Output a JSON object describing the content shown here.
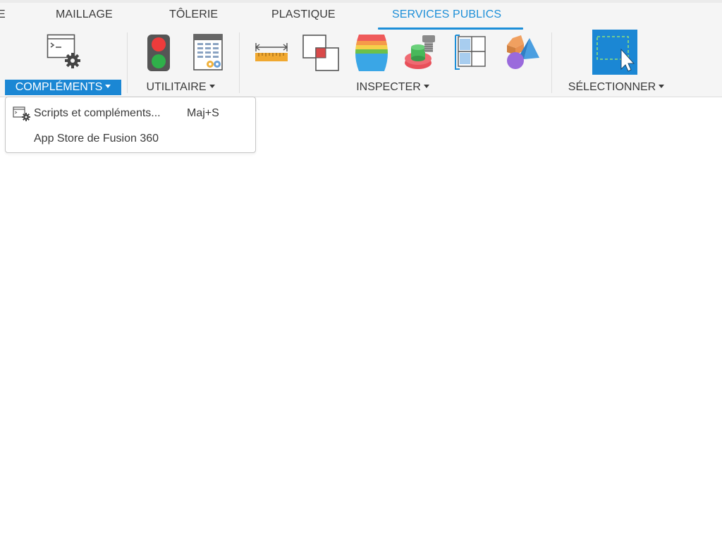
{
  "tabs": [
    {
      "label": "E"
    },
    {
      "label": "MAILLAGE"
    },
    {
      "label": "TÔLERIE"
    },
    {
      "label": "PLASTIQUE"
    },
    {
      "label": "SERVICES PUBLICS"
    }
  ],
  "active_tab": "SERVICES PUBLICS",
  "ribbon": {
    "groups": [
      {
        "label": "COMPLÉMENTS",
        "active": true,
        "icons": [
          "scripts-addins-icon"
        ]
      },
      {
        "label": "UTILITAIRE",
        "active": false,
        "icons": [
          "traffic-light-icon",
          "parameters-table-icon"
        ]
      },
      {
        "label": "INSPECTER",
        "active": false,
        "icons": [
          "measure-ruler-icon",
          "interference-icon",
          "curvature-analysis-icon",
          "draft-analysis-icon",
          "section-analysis-icon",
          "component-color-icon"
        ]
      },
      {
        "label": "SÉLECTIONNER",
        "active": false,
        "icons": [
          "window-select-icon"
        ]
      }
    ]
  },
  "dropdown": {
    "items": [
      {
        "label": "Scripts et compléments...",
        "shortcut": "Maj+S",
        "icon": "scripts-addins-icon"
      },
      {
        "label": "App Store de Fusion 360",
        "shortcut": ""
      }
    ]
  },
  "colors": {
    "accent": "#1d8fd8",
    "active_group_bg": "#1b87d4",
    "ribbon_bg": "#f5f5f5",
    "text": "#3a3a3a"
  }
}
